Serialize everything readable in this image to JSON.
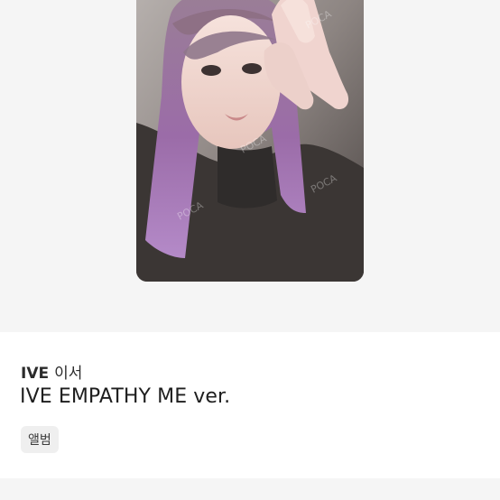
{
  "product": {
    "artist": "IVE",
    "member": "이서",
    "title": "IVE EMPATHY ME ver.",
    "tag": "앨범"
  },
  "image": {
    "watermark": "POCA"
  }
}
